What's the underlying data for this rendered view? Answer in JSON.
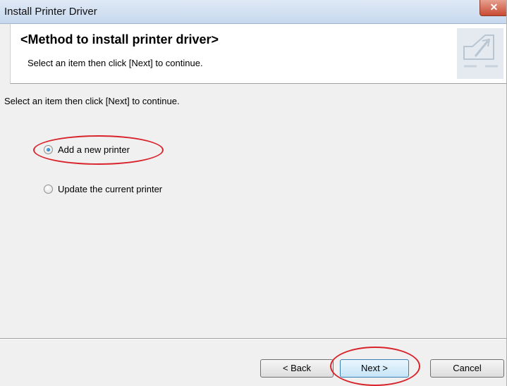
{
  "window": {
    "title": "Install Printer Driver",
    "close_glyph": "✕"
  },
  "header": {
    "title": "<Method to install printer driver>",
    "subtitle": "Select an item then click [Next] to continue.",
    "icon": "wizard-setup-icon"
  },
  "body": {
    "instruction": "Select an item then click [Next] to continue.",
    "options": [
      {
        "label": "Add a new printer",
        "checked": true
      },
      {
        "label": "Update the current printer",
        "checked": false
      }
    ]
  },
  "buttons": {
    "back": "< Back",
    "next": "Next >",
    "cancel": "Cancel"
  },
  "colors": {
    "annotation": "#d9232b",
    "accent": "#0f5fa8"
  }
}
